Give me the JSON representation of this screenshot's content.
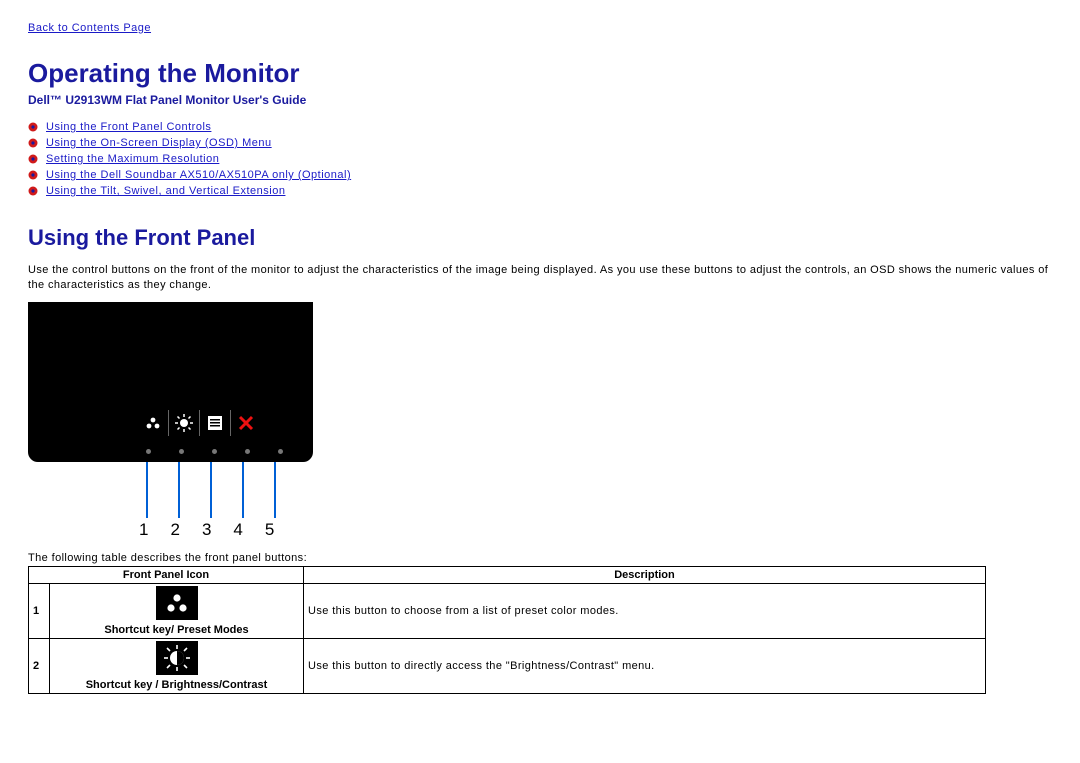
{
  "back_link": "Back to Contents Page",
  "title": "Operating the Monitor",
  "subtitle": "Dell™ U2913WM Flat Panel Monitor User's Guide",
  "toc": [
    "Using the Front Panel Controls",
    "Using the On-Screen Display (OSD) Menu",
    "Setting the Maximum Resolution",
    "Using the Dell Soundbar AX510/AX510PA only (Optional)",
    "Using the Tilt, Swivel, and Vertical Extension"
  ],
  "section_heading": "Using the Front Panel",
  "section_intro": "Use the control buttons on the front of the monitor to adjust the characteristics of the image being displayed. As you use these buttons to adjust the controls, an OSD shows the numeric values of the characteristics as they change.",
  "diagram_numbers": [
    "1",
    "2",
    "3",
    "4",
    "5"
  ],
  "table_caption": "The following table describes the front panel buttons:",
  "table_headers": {
    "icon": "Front Panel Icon",
    "desc": "Description"
  },
  "rows": [
    {
      "num": "1",
      "icon_caption": "Shortcut key/ Preset Modes",
      "desc": "Use this button to choose from a list of preset color modes."
    },
    {
      "num": "2",
      "icon_caption": "Shortcut key / Brightness/Contrast",
      "desc": "Use this button to directly access the \"Brightness/Contrast\" menu."
    }
  ]
}
